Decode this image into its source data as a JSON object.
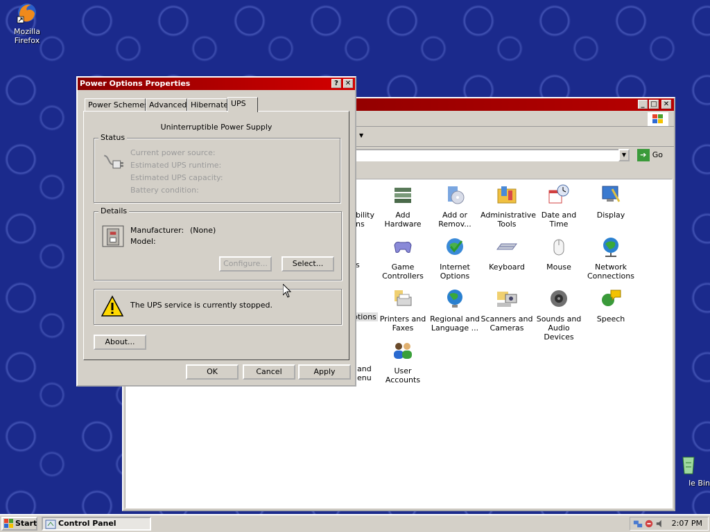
{
  "desktop": {
    "firefox_label": "Mozilla Firefox",
    "recycle_label": "le Bin"
  },
  "control_panel": {
    "address_go": "Go",
    "items": [
      {
        "id": "accessibility",
        "label": "bility\nns"
      },
      {
        "id": "add-hardware",
        "label": "Add Hardware"
      },
      {
        "id": "add-remove",
        "label": "Add or\nRemov..."
      },
      {
        "id": "admin-tools",
        "label": "Administrative\nTools"
      },
      {
        "id": "date-time",
        "label": "Date and Time"
      },
      {
        "id": "display",
        "label": "Display"
      },
      {
        "id": "fonts",
        "label": "s"
      },
      {
        "id": "game-controllers",
        "label": "Game\nControllers"
      },
      {
        "id": "internet-options",
        "label": "Internet\nOptions"
      },
      {
        "id": "keyboard",
        "label": "Keyboard"
      },
      {
        "id": "mouse",
        "label": "Mouse"
      },
      {
        "id": "network",
        "label": "Network\nConnections"
      },
      {
        "id": "power-options",
        "label": "ptions"
      },
      {
        "id": "printers",
        "label": "Printers and\nFaxes"
      },
      {
        "id": "regional",
        "label": "Regional and\nLanguage ..."
      },
      {
        "id": "scanners",
        "label": "Scanners and\nCameras"
      },
      {
        "id": "sounds",
        "label": "Sounds and\nAudio Devices"
      },
      {
        "id": "speech",
        "label": "Speech"
      },
      {
        "id": "taskbar-start",
        "label": "and\nenu"
      },
      {
        "id": "user-accounts",
        "label": "User Accounts"
      }
    ]
  },
  "dialog": {
    "title": "Power Options Properties",
    "tabs": [
      "Power Schemes",
      "Advanced",
      "Hibernate",
      "UPS"
    ],
    "active_tab": "UPS",
    "heading": "Uninterruptible Power Supply",
    "status": {
      "label": "Status",
      "lines": [
        "Current power source:",
        "Estimated UPS runtime:",
        "Estimated UPS capacity:",
        "Battery condition:"
      ]
    },
    "details": {
      "label": "Details",
      "manufacturer_label": "Manufacturer:",
      "manufacturer_value": "(None)",
      "model_label": "Model:",
      "configure": "Configure...",
      "select": "Select..."
    },
    "warning": "The UPS service is currently stopped.",
    "about": "About...",
    "ok": "OK",
    "cancel": "Cancel",
    "apply": "Apply"
  },
  "taskbar": {
    "start": "Start",
    "task_control_panel": "Control Panel",
    "clock": "2:07 PM"
  }
}
